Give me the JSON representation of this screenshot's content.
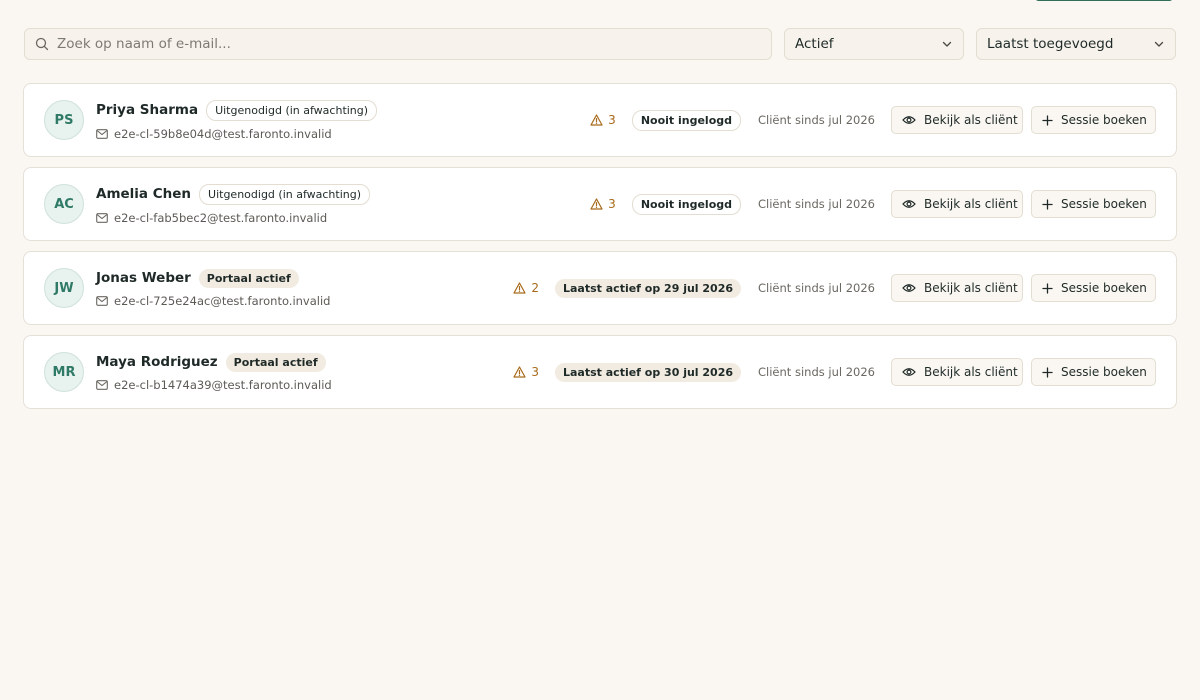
{
  "filters": {
    "search_placeholder": "Zoek op naam of e-mail...",
    "status_value": "Actief",
    "sort_value": "Laatst toegevoegd"
  },
  "colors": {
    "accent": "#2f6f5c",
    "warning": "#a86a1a",
    "background": "#faf7f2"
  },
  "clients": [
    {
      "initials": "PS",
      "name": "Priya Sharma",
      "portal_status": "Uitgenodigd (in afwachting)",
      "email": "e2e-cl-59b8e04d@test.faronto.invalid",
      "warnings": "3",
      "activity": "Nooit ingelogd",
      "since": "Cliënt sinds jul 2026",
      "view_label": "Bekijk als cliënt",
      "book_label": "Sessie boeken"
    },
    {
      "initials": "AC",
      "name": "Amelia Chen",
      "portal_status": "Uitgenodigd (in afwachting)",
      "email": "e2e-cl-fab5bec2@test.faronto.invalid",
      "warnings": "3",
      "activity": "Nooit ingelogd",
      "since": "Cliënt sinds jul 2026",
      "view_label": "Bekijk als cliënt",
      "book_label": "Sessie boeken"
    },
    {
      "initials": "JW",
      "name": "Jonas Weber",
      "portal_status": "Portaal actief",
      "email": "e2e-cl-725e24ac@test.faronto.invalid",
      "warnings": "2",
      "activity": "Laatst actief op 29 jul 2026",
      "since": "Cliënt sinds jul 2026",
      "view_label": "Bekijk als cliënt",
      "book_label": "Sessie boeken"
    },
    {
      "initials": "MR",
      "name": "Maya Rodriguez",
      "portal_status": "Portaal actief",
      "email": "e2e-cl-b1474a39@test.faronto.invalid",
      "warnings": "3",
      "activity": "Laatst actief op 30 jul 2026",
      "since": "Cliënt sinds jul 2026",
      "view_label": "Bekijk als cliënt",
      "book_label": "Sessie boeken"
    }
  ]
}
